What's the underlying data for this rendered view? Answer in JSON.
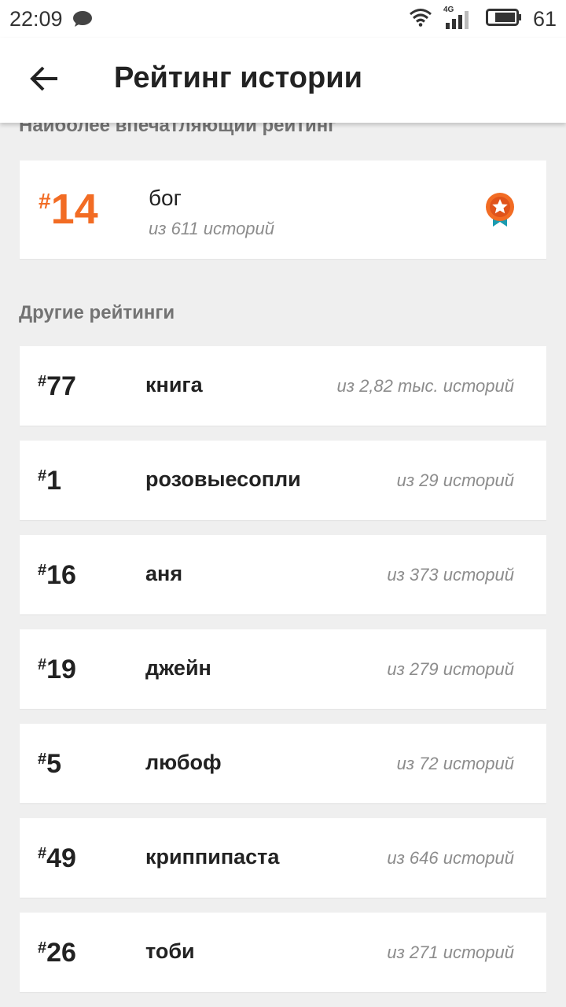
{
  "status_bar": {
    "time": "22:09",
    "network_label": "4G",
    "battery": "61",
    "icons": [
      "chat-bubble-icon",
      "wifi-icon",
      "signal-icon",
      "battery-icon"
    ]
  },
  "header": {
    "title": "Рейтинг истории",
    "back_icon": "arrow-left-icon"
  },
  "featured": {
    "section_title": "Наиболее впечатляющий рейтинг",
    "hash": "#",
    "rank": "14",
    "tag": "бог",
    "subtitle": "из 611 историй",
    "badge_icon": "medal-star-icon",
    "accent_color": "#f26c24"
  },
  "others": {
    "section_title": "Другие рейтинги",
    "hash": "#",
    "items": [
      {
        "rank": "77",
        "tag": "книга",
        "count": "из 2,82 тыс. историй"
      },
      {
        "rank": "1",
        "tag": "розовыесопли",
        "count": "из 29 историй"
      },
      {
        "rank": "16",
        "tag": "аня",
        "count": "из 373 историй"
      },
      {
        "rank": "19",
        "tag": "джейн",
        "count": "из 279 историй"
      },
      {
        "rank": "5",
        "tag": "любоф",
        "count": "из 72 историй"
      },
      {
        "rank": "49",
        "tag": "криппипаста",
        "count": "из 646 историй"
      },
      {
        "rank": "26",
        "tag": "тоби",
        "count": "из 271 историй"
      }
    ]
  }
}
